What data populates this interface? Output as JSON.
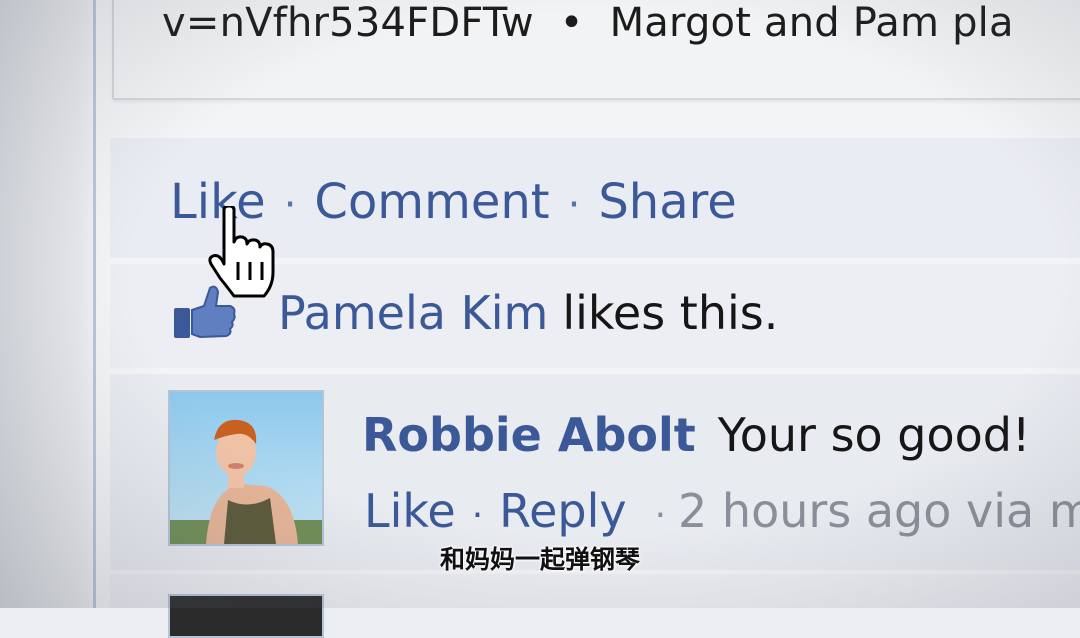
{
  "post": {
    "url_fragment": "v=nVfhr534FDFTw",
    "separator": "•",
    "caption": "Margot and Pam pla"
  },
  "actions": {
    "like_label": "Like",
    "comment_label": "Comment",
    "share_label": "Share",
    "separator": "·"
  },
  "likes": {
    "name": "Pamela Kim",
    "text": "likes this.",
    "icon": "thumbs-up-icon"
  },
  "comment": {
    "author": "Robbie Abolt",
    "text": "Your so good!",
    "like_label": "Like",
    "reply_label": "Reply",
    "separator": "·",
    "timestamp": "2 hours ago via m"
  },
  "subtitle": "和妈妈一起弹钢琴",
  "colors": {
    "link": "#3b5998",
    "text": "#161616",
    "muted": "#8a8f99"
  }
}
